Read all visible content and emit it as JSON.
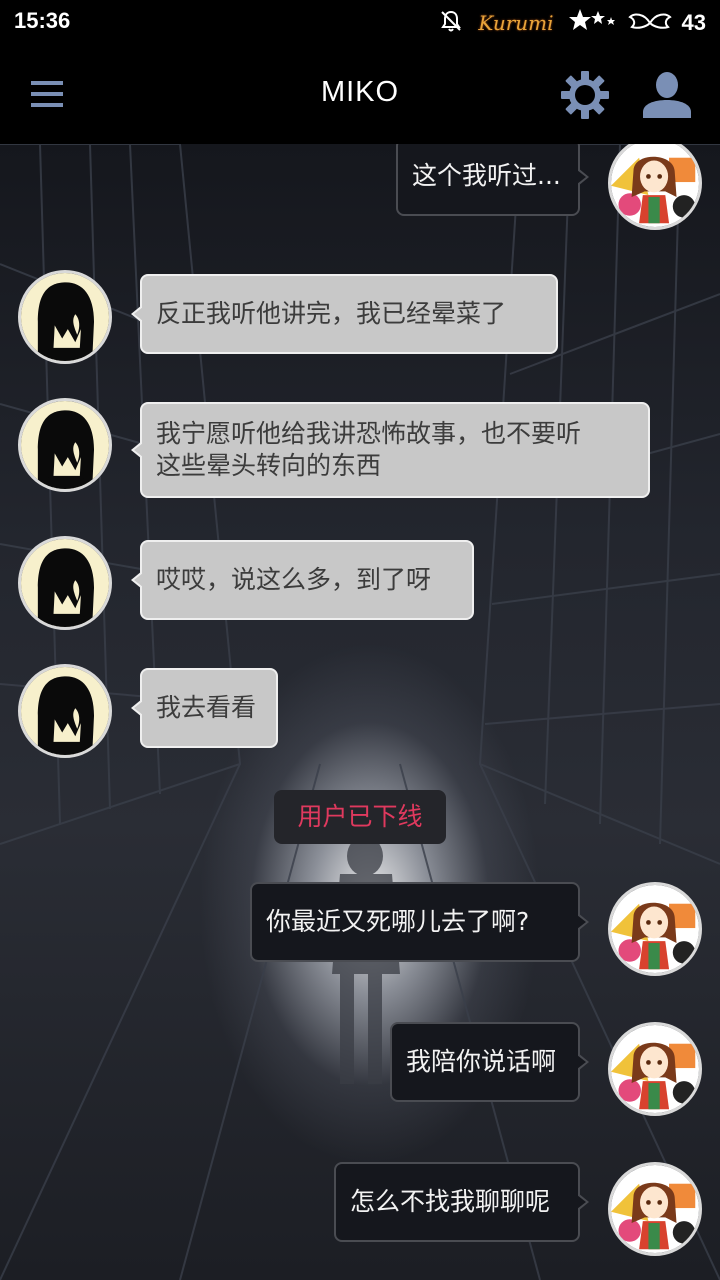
{
  "status_bar": {
    "time": "15:36",
    "icons": [
      "bell-off-icon",
      "kurumi-logo",
      "stars-icon",
      "wings-icon"
    ],
    "brand_logo_text": "Kurumi",
    "battery": "43"
  },
  "app_bar": {
    "title": "MIKO",
    "icons": [
      "menu-icon",
      "gear-icon",
      "user-icon"
    ],
    "accent_color": "#7a8fb5"
  },
  "messages": [
    {
      "sender": "self",
      "lines": [
        "这个我听过..."
      ]
    },
    {
      "sender": "miko",
      "lines": [
        "反正我听他讲完，我已经晕菜了"
      ]
    },
    {
      "sender": "miko",
      "lines": [
        "我宁愿听他给我讲恐怖故事，也不要听",
        "这些晕头转向的东西"
      ]
    },
    {
      "sender": "miko",
      "lines": [
        "哎哎，说这么多，到了呀"
      ]
    },
    {
      "sender": "miko",
      "lines": [
        "我去看看"
      ]
    },
    {
      "sender": "system",
      "lines": [
        "用户已下线"
      ]
    },
    {
      "sender": "self",
      "lines": [
        "你最近又死哪儿去了啊?"
      ]
    },
    {
      "sender": "self",
      "lines": [
        "我陪你说话啊"
      ]
    },
    {
      "sender": "self",
      "lines": [
        "怎么不找我聊聊呢"
      ]
    }
  ],
  "colors": {
    "incoming_bubble": "#c8c8c8",
    "outgoing_bubble": "#15171d",
    "system_text": "#e0395e"
  }
}
